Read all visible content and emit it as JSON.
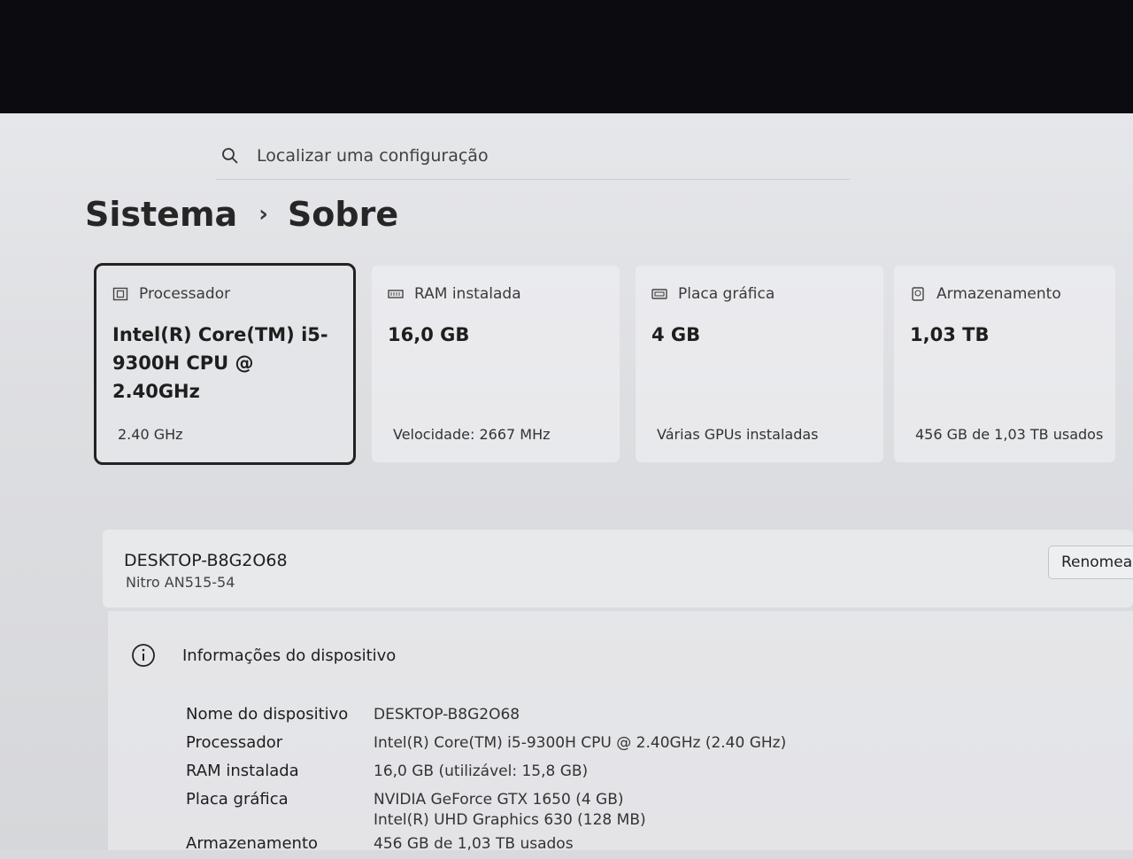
{
  "search": {
    "placeholder": "Localizar uma configuração"
  },
  "breadcrumb": {
    "parent": "Sistema",
    "current": "Sobre"
  },
  "specs_cards": [
    {
      "title": "Processador",
      "value": "Intel(R) Core(TM) i5-9300H CPU @ 2.40GHz",
      "detail": "2.40 GHz",
      "icon": "processor-icon"
    },
    {
      "title": "RAM instalada",
      "value": "16,0 GB",
      "detail": "Velocidade: 2667 MHz",
      "icon": "ram-icon"
    },
    {
      "title": "Placa gráfica",
      "value": "4 GB",
      "detail": "Várias GPUs instaladas",
      "icon": "gpu-icon"
    },
    {
      "title": "Armazenamento",
      "value": "1,03 TB",
      "detail": "456 GB de 1,03 TB usados",
      "icon": "storage-icon"
    }
  ],
  "device": {
    "name": "DESKTOP-B8G2O68",
    "model": "Nitro AN515-54",
    "rename_label": "Renomear"
  },
  "device_info": {
    "title": "Informações do dispositivo",
    "rows": [
      {
        "label": "Nome do dispositivo",
        "value": "DESKTOP-B8G2O68"
      },
      {
        "label": "Processador",
        "value": "Intel(R) Core(TM) i5-9300H CPU @ 2.40GHz (2.40 GHz)"
      },
      {
        "label": "RAM instalada",
        "value": "16,0 GB (utilizável: 15,8 GB)"
      },
      {
        "label": "Placa gráfica",
        "value": "NVIDIA GeForce GTX 1650 (4 GB)",
        "value2": "Intel(R) UHD Graphics 630 (128 MB)"
      },
      {
        "label": "Armazenamento",
        "value": "456 GB de 1,03 TB usados"
      }
    ]
  }
}
